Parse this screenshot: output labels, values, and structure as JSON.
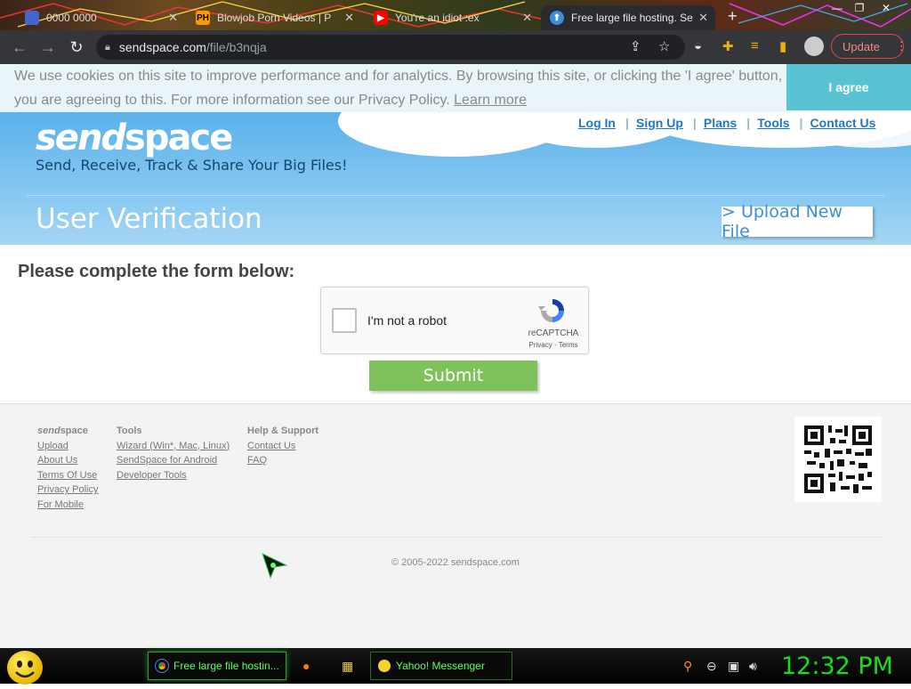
{
  "browser": {
    "tabs": [
      {
        "label": "0000 0000",
        "favicon": "flag-icon",
        "active": false
      },
      {
        "label": "Blowjob Porn Videos | P",
        "favicon_text": "PH",
        "active": false
      },
      {
        "label": "You're an idiot :ex",
        "favicon": "youtube-icon",
        "active": false
      },
      {
        "label": "Free large file hosting. Se",
        "favicon": "sendspace-icon",
        "active": true
      }
    ],
    "close_glyph": "✕",
    "new_tab_glyph": "+",
    "url_host": "sendspace.com",
    "url_path": "/file/b3nqja",
    "update_label": "Update",
    "update_menu_glyph": "⋮"
  },
  "cookie_banner": {
    "text_line1": "We use cookies on this site to improve performance and for analytics. By browsing this site, or clicking the 'I agree' button,",
    "text_line2": "you are agreeing to this. For more information see our Privacy Policy.",
    "learn_more": "Learn more",
    "agree_button": "I agree"
  },
  "header": {
    "logo_a": "send",
    "logo_b": "space",
    "tagline": "Send, Receive, Track & Share Your Big Files!",
    "nav": [
      "Log In",
      "Sign Up",
      "Plans",
      "Tools",
      "Contact Us"
    ],
    "page_title": "User Verification",
    "upload_button": "> Upload New File"
  },
  "form": {
    "title": "Please complete the form below:",
    "captcha_label": "I'm not a robot",
    "captcha_brand": "reCAPTCHA",
    "captcha_links": "Privacy - Terms",
    "submit": "Submit"
  },
  "footer": {
    "col1_heading_a": "send",
    "col1_heading_b": "space",
    "col1": [
      "Upload",
      "About Us",
      "Terms Of Use",
      "Privacy Policy",
      "For Mobile"
    ],
    "col2_heading": "Tools",
    "col2": [
      "Wizard (Win*, Mac, Linux)",
      "SendSpace for Android",
      "Developer Tools"
    ],
    "col3_heading": "Help & Support",
    "col3": [
      "Contact Us",
      "FAQ"
    ],
    "copyright": "© 2005-2022 sendspace.com"
  },
  "taskbar": {
    "tasks": [
      {
        "label": "Free large file hostin...",
        "icon": "chrome-icon"
      },
      {
        "label": "Yahoo! Messenger",
        "icon": "yahoo-messenger-icon"
      }
    ],
    "clock": "12:32 PM"
  },
  "colors": {
    "header_blue": "#5bb1ea",
    "submit_green": "#7fc25b",
    "agree_teal": "#5ac3d3",
    "link_blue": "#1f78c8",
    "clock_green": "#14e014"
  }
}
